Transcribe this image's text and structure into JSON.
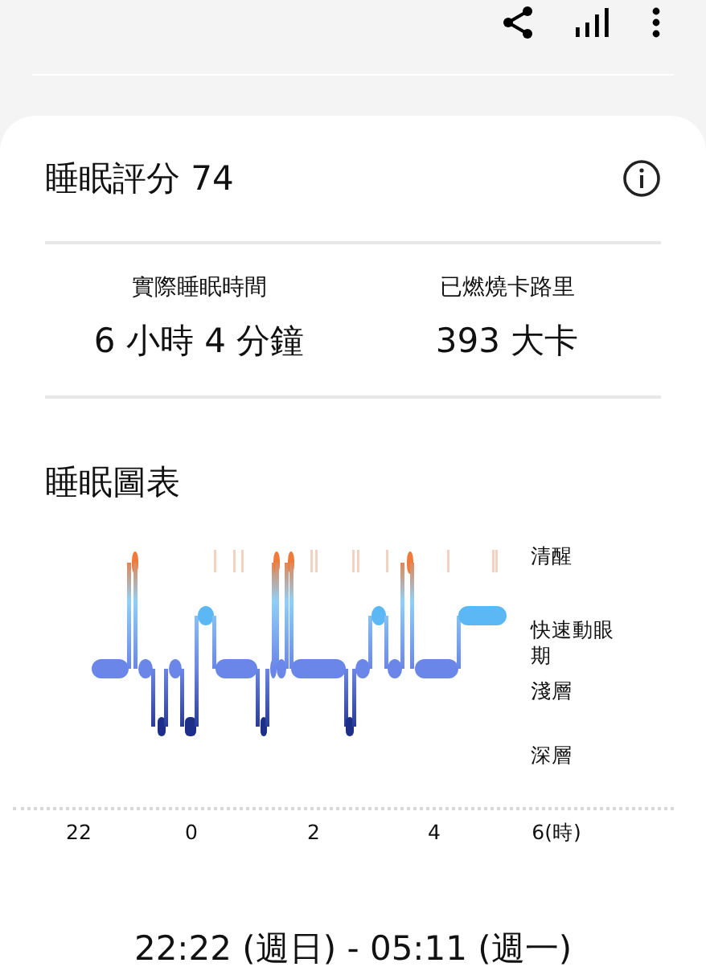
{
  "score_card": {
    "title": "睡眠評分 74"
  },
  "stats": [
    {
      "label": "實際睡眠時間",
      "value": "6 小時 4 分鐘"
    },
    {
      "label": "已燃燒卡路里",
      "value": "393 大卡"
    }
  ],
  "sleep_chart": {
    "title": "睡眠圖表",
    "stages": [
      "清醒",
      "快速動眼期",
      "淺層",
      "深層"
    ],
    "x_labels": [
      "22",
      "0",
      "2",
      "4",
      "6(時)"
    ]
  },
  "time_range": "22:22 (週日) - 05:11 (週一)"
}
